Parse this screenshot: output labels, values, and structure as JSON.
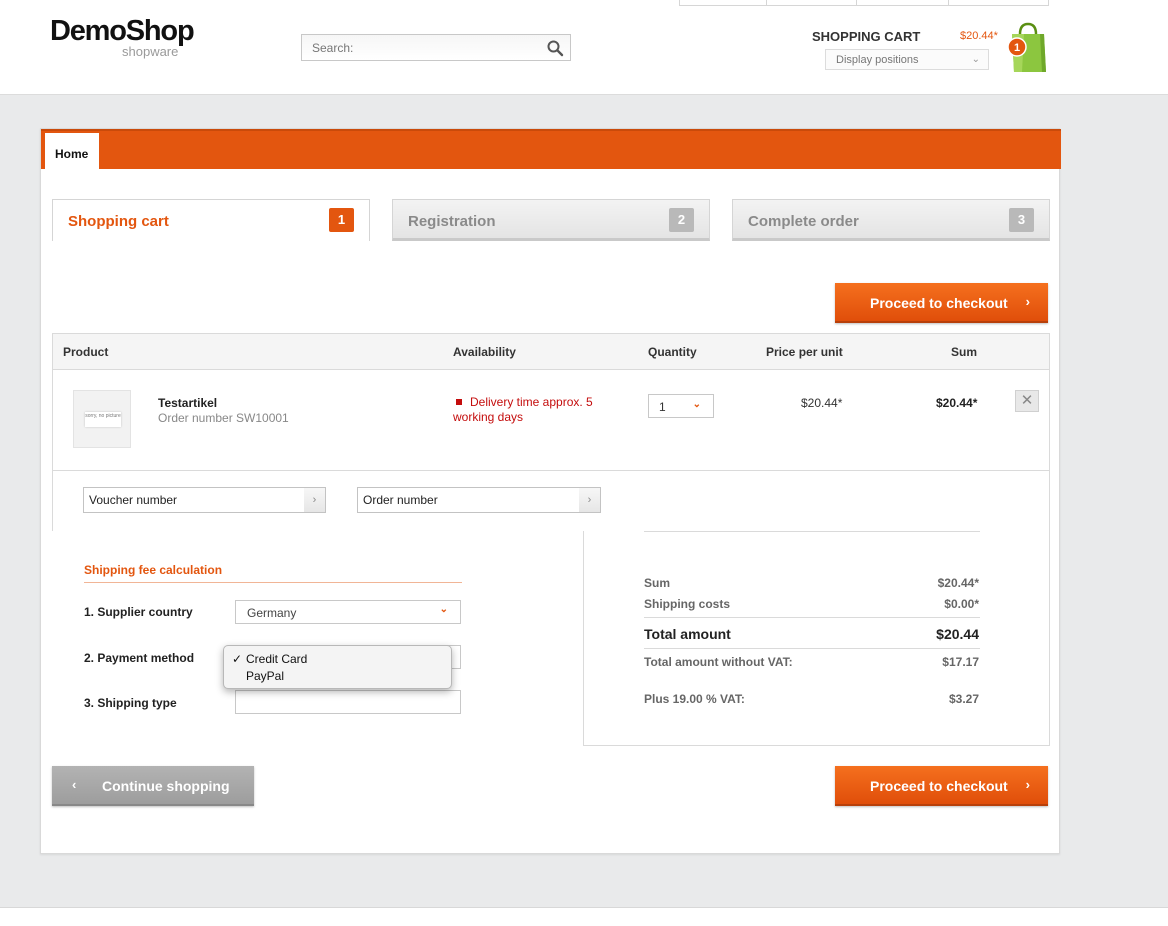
{
  "header": {
    "logo_main": "DemoShop",
    "logo_sub": "shopware",
    "search_placeholder": "Search:",
    "cart_title": "SHOPPING CART",
    "cart_amount": "$20.44*",
    "display_positions": "Display positions",
    "cart_count": "1"
  },
  "nav": {
    "home": "Home"
  },
  "steps": [
    {
      "label": "Shopping cart",
      "num": "1"
    },
    {
      "label": "Registration",
      "num": "2"
    },
    {
      "label": "Complete order",
      "num": "3"
    }
  ],
  "buttons": {
    "proceed": "Proceed to checkout",
    "continue": "Continue shopping"
  },
  "table": {
    "headers": [
      "Product",
      "Availability",
      "Quantity",
      "Price per unit",
      "Sum"
    ],
    "row": {
      "thumb_text": "sorry, no picture",
      "name": "Testartikel",
      "order_number": "Order number SW10001",
      "availability": "Delivery time approx. 5 working days",
      "quantity": "1",
      "price": "$20.44*",
      "sum": "$20.44*"
    }
  },
  "voucher": {
    "placeholder": "Voucher number"
  },
  "order_number_field": {
    "placeholder": "Order number"
  },
  "shipping": {
    "title": "Shipping fee calculation",
    "supplier_label": "1. Supplier country",
    "supplier_value": "Germany",
    "payment_label": "2. Payment method",
    "payment_options": [
      "Credit Card",
      "PayPal"
    ],
    "payment_selected": "Credit Card",
    "shipping_label": "3. Shipping type"
  },
  "totals": {
    "sum_label": "Sum",
    "sum_value": "$20.44*",
    "shipping_label": "Shipping costs",
    "shipping_value": "$0.00*",
    "total_label": "Total amount",
    "total_value": "$20.44",
    "novat_label": "Total amount without VAT:",
    "novat_value": "$17.17",
    "vat_label": "Plus 19.00 % VAT:",
    "vat_value": "$3.27"
  },
  "colors": {
    "accent": "#e3560f",
    "error": "#c40d0d",
    "background": "#e9eaeb"
  }
}
